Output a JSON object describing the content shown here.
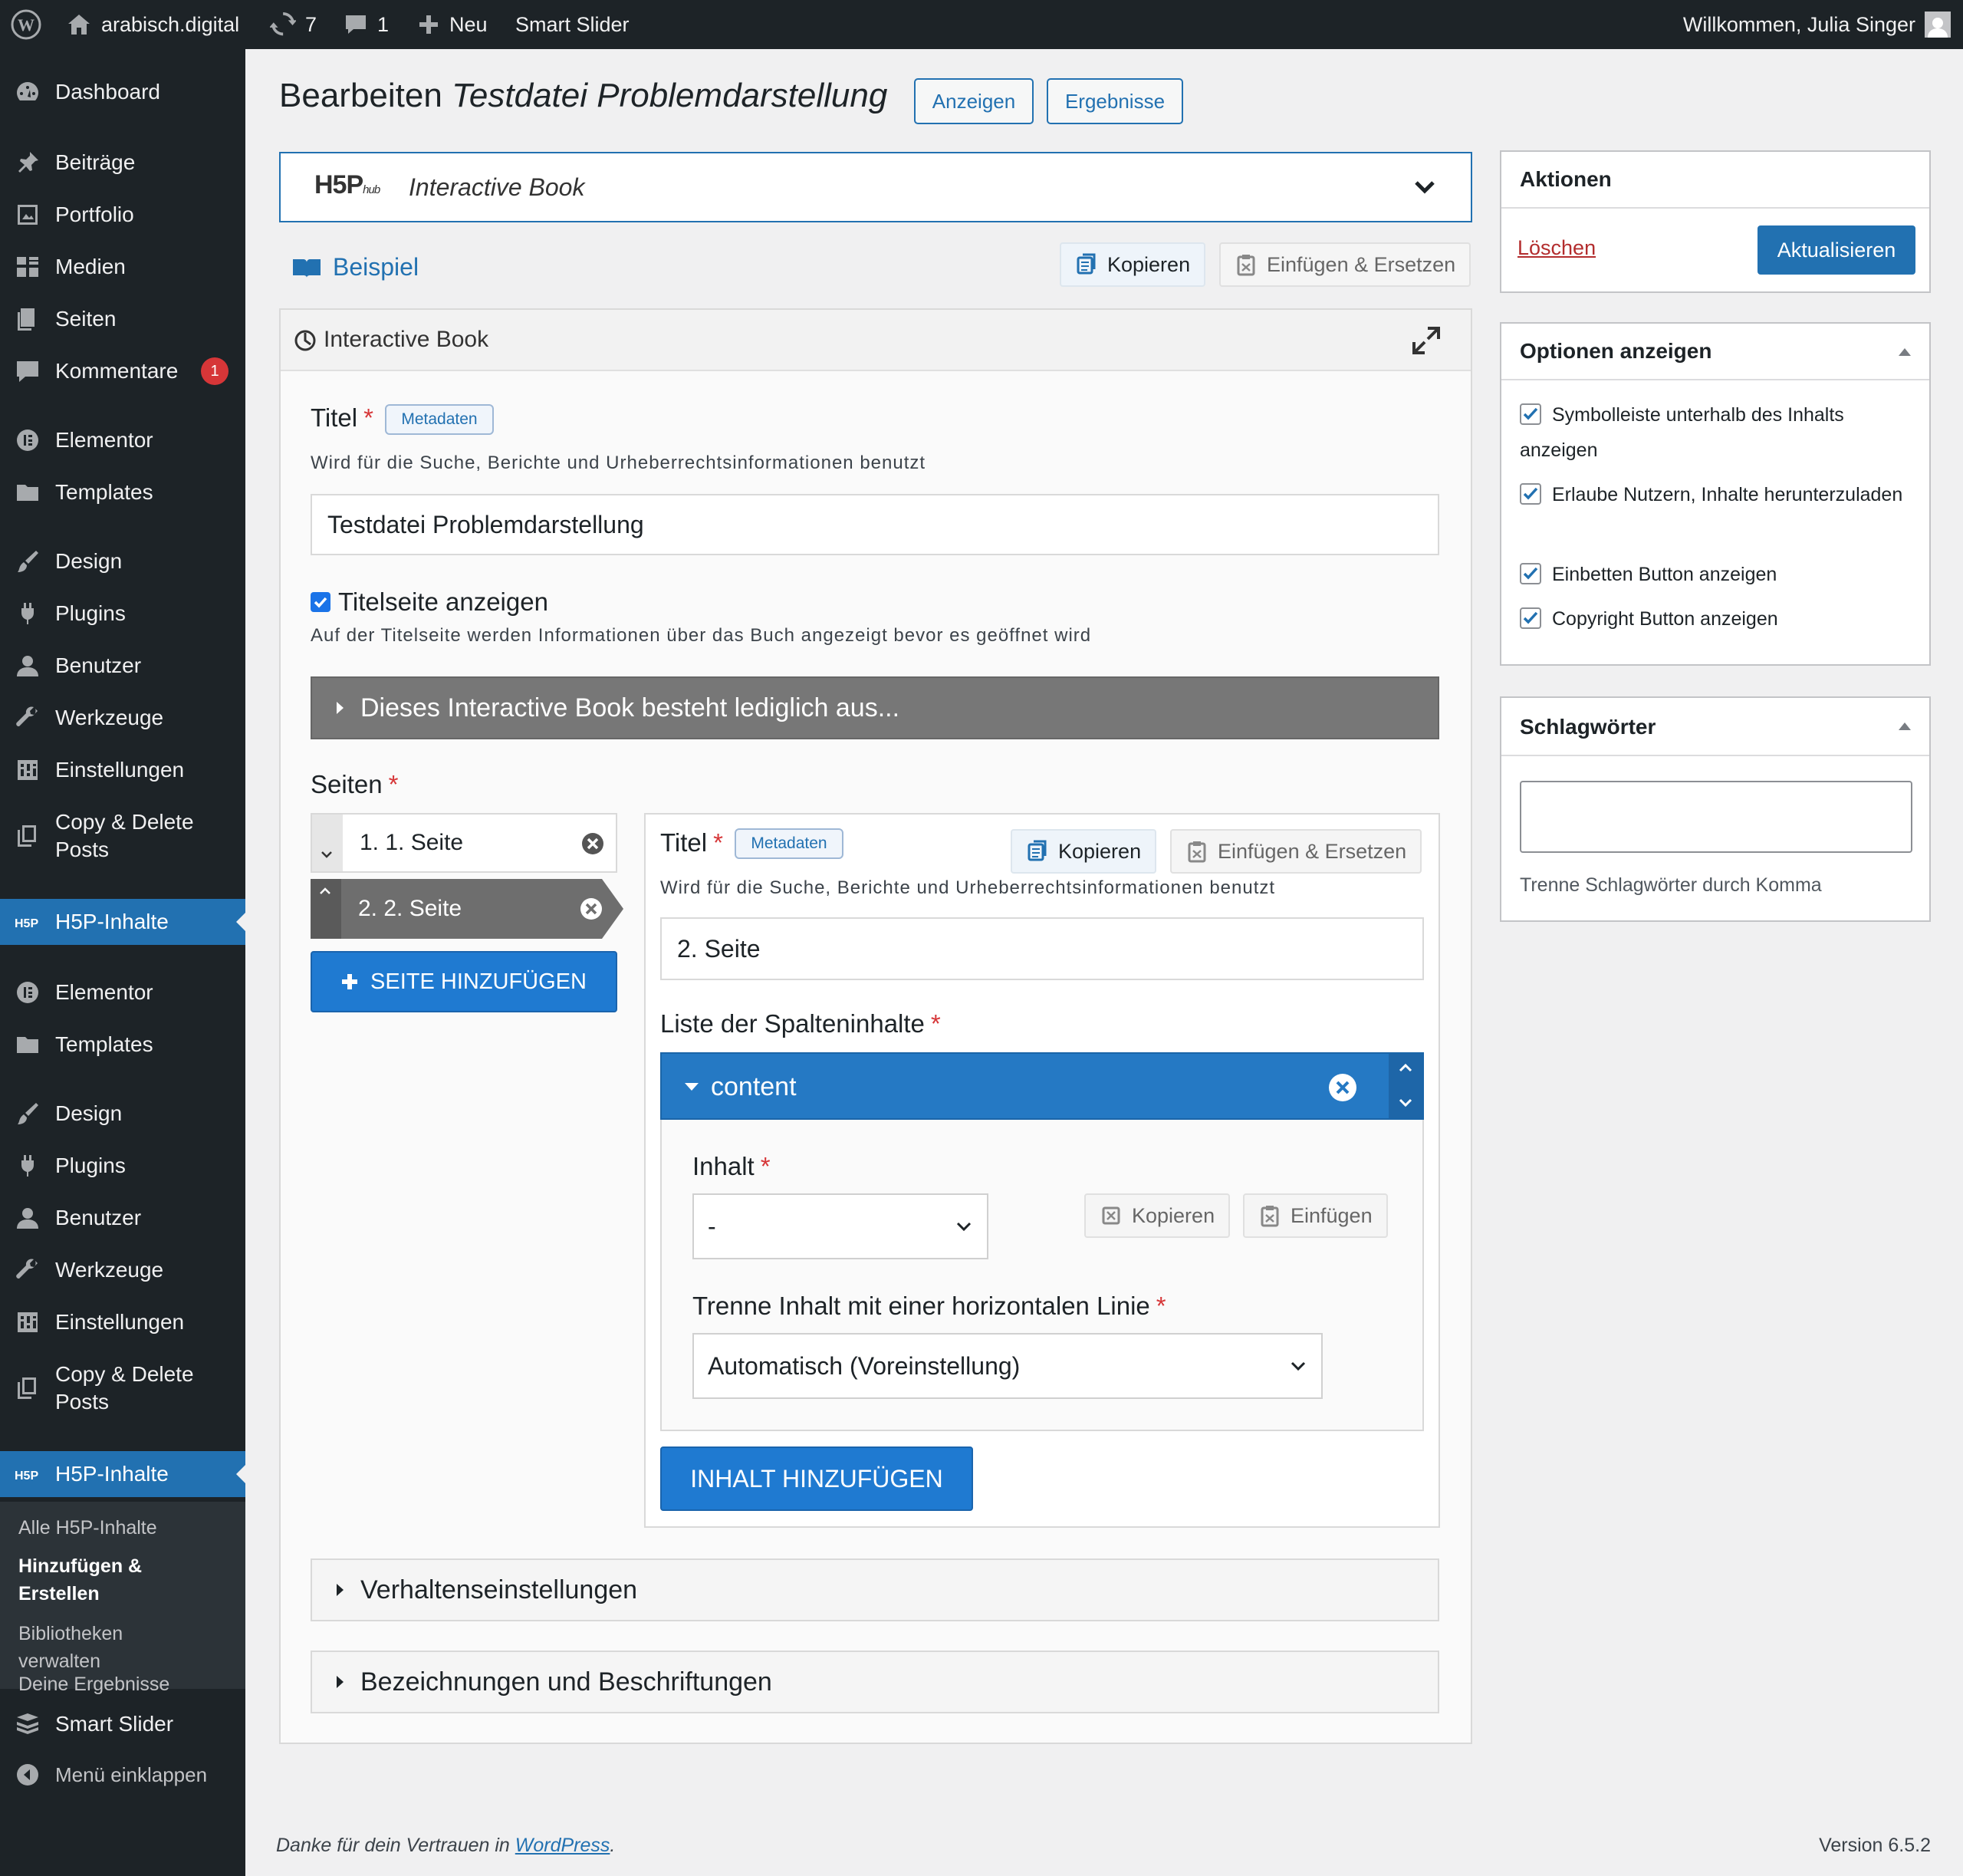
{
  "adminbar": {
    "site": "arabisch.digital",
    "updates": "7",
    "comments": "1",
    "new": "Neu",
    "smart_slider": "Smart Slider",
    "welcome": "Willkommen, Julia Singer"
  },
  "sidebar": {
    "group1": [
      {
        "label": "Dashboard",
        "icon": "dashboard-icon"
      },
      {
        "label": "Beiträge",
        "icon": "pin-icon"
      },
      {
        "label": "Portfolio",
        "icon": "portfolio-icon"
      },
      {
        "label": "Medien",
        "icon": "media-icon"
      },
      {
        "label": "Seiten",
        "icon": "pages-icon"
      },
      {
        "label": "Kommentare",
        "icon": "comments-icon",
        "badge": "1"
      },
      {
        "label": "Elementor",
        "icon": "elementor-icon"
      },
      {
        "label": "Templates",
        "icon": "folder-icon"
      },
      {
        "label": "Design",
        "icon": "brush-icon"
      },
      {
        "label": "Plugins",
        "icon": "plugin-icon"
      },
      {
        "label": "Benutzer",
        "icon": "user-icon"
      },
      {
        "label": "Werkzeuge",
        "icon": "wrench-icon"
      },
      {
        "label": "Einstellungen",
        "icon": "settings-icon"
      },
      {
        "label": "Copy & Delete Posts",
        "icon": "copy-icon"
      },
      {
        "label": "H5P-Inhalte",
        "icon": "h5p-icon"
      }
    ],
    "group2": [
      {
        "label": "Elementor"
      },
      {
        "label": "Templates"
      },
      {
        "label": "Design"
      },
      {
        "label": "Plugins"
      },
      {
        "label": "Benutzer"
      },
      {
        "label": "Werkzeuge"
      },
      {
        "label": "Einstellungen"
      },
      {
        "label": "Copy & Delete Posts"
      },
      {
        "label": "H5P-Inhalte"
      }
    ],
    "submenu": [
      "Alle H5P-Inhalte",
      "Hinzufügen & Erstellen",
      "Bibliotheken verwalten",
      "Deine Ergebnisse"
    ],
    "smart_slider": "Smart Slider",
    "collapse": "Menü einklappen"
  },
  "page": {
    "title_prefix": "Bearbeiten",
    "title_italic": "Testdatei Problemdarstellung",
    "btn_view": "Anzeigen",
    "btn_results": "Ergebnisse"
  },
  "hub": {
    "logo": "H5P",
    "logo_sub": "hub",
    "type": "Interactive Book"
  },
  "editor": {
    "example": "Beispiel",
    "copy": "Kopieren",
    "paste_replace": "Einfügen & Ersetzen",
    "head": "Interactive Book",
    "title_label": "Titel",
    "metadata": "Metadaten",
    "title_desc": "Wird für die Suche, Berichte und Urheberrechtsinformationen benutzt",
    "title_value": "Testdatei Problemdarstellung",
    "cover_label": "Titelseite anzeigen",
    "cover_desc": "Auf der Titelseite werden Informationen über das Buch angezeigt bevor es geöffnet wird",
    "cover_group": "Dieses Interactive Book besteht lediglich aus...",
    "pages_label": "Seiten",
    "pages": [
      "1. 1. Seite",
      "2. 2. Seite"
    ],
    "add_page": "SEITE HINZUFÜGEN",
    "page_title_value": "2. Seite",
    "columns_label": "Liste der Spalteninhalte",
    "content_head": "content",
    "inhalt_label": "Inhalt",
    "inhalt_value": "-",
    "paste": "Einfügen",
    "separator_label": "Trenne Inhalt mit einer horizontalen Linie",
    "separator_value": "Automatisch (Voreinstellung)",
    "add_content": "INHALT HINZUFÜGEN",
    "behaviour": "Verhaltenseinstellungen",
    "labels": "Bezeichnungen und Beschriftungen"
  },
  "actions": {
    "title": "Aktionen",
    "delete": "Löschen",
    "update": "Aktualisieren"
  },
  "options": {
    "title": "Optionen anzeigen",
    "items": [
      "Symbolleiste unterhalb des Inhalts anzeigen",
      "Erlaube Nutzern, Inhalte herunterzuladen",
      "Einbetten Button anzeigen",
      "Copyright Button anzeigen"
    ]
  },
  "tags": {
    "title": "Schlagwörter",
    "hint": "Trenne Schlagwörter durch Komma"
  },
  "footer": {
    "thanks": "Danke für dein Vertrauen in",
    "wp": "WordPress",
    "version": "Version 6.5.2"
  },
  "colors": {
    "accent": "#2271b1",
    "admin_dark": "#1d2327",
    "danger": "#d63638"
  }
}
